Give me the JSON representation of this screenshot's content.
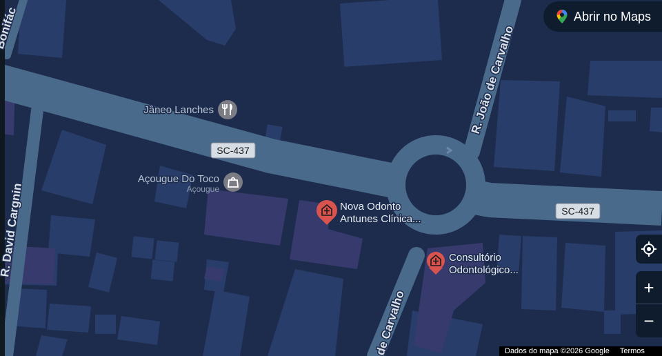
{
  "map": {
    "route": "SC-437",
    "streets": {
      "joao_north": "R. João de Carvalho",
      "joao_south": "de Carvalho",
      "david": "R. David Cargnin",
      "bonifacio": "Bonifác"
    },
    "places": {
      "janeo": "Jâneo Lanches",
      "acougue_name": "Açougue Do Toco",
      "acougue_category": "Açougue",
      "nova_line1": "Nova Odonto",
      "nova_line2": "Antunes Clínica...",
      "consult_line1": "Consultório",
      "consult_line2": "Odontológico..."
    },
    "icons": {
      "restaurant": "restaurant-icon",
      "shopping": "shopping-bag-icon",
      "medical": "medical-pin-icon"
    },
    "colors": {
      "background": "#1d2c4d",
      "road": "#4a6a8c",
      "building": "#283d6a",
      "building_alt": "#373a6c",
      "label": "#b8c4d4",
      "shield_bg": "#d7dde4",
      "medical_pin": "#d9534f"
    }
  },
  "controls": {
    "open_maps": "Abrir no Maps",
    "zoom_in": "+",
    "zoom_out": "−"
  },
  "footer": {
    "data_credit": "Dados do mapa ©2026 Google",
    "terms": "Termos"
  }
}
